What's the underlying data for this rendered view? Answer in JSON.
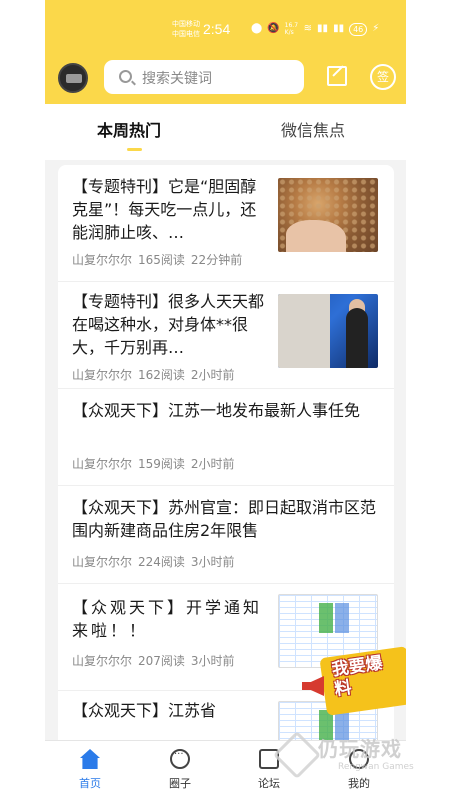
{
  "status_bar": {
    "carrier_1": "中国移动",
    "carrier_2": "中国电信",
    "time": "2:54",
    "net_speed": "16.7 K/s",
    "battery": "46"
  },
  "header": {
    "search_placeholder": "搜索关键词",
    "sign_label": "签",
    "accent_color": "#fbd84a"
  },
  "tabs": [
    {
      "label": "本周热门",
      "active": true
    },
    {
      "label": "微信焦点",
      "active": false
    }
  ],
  "feed": [
    {
      "title": "【专题特刊】它是“胆固醇克星”！每天吃一点儿，还能润肺止咳、…",
      "author": "山复尔尔尔",
      "reads": "165阅读",
      "time": "22分钟前",
      "thumb": "seeds"
    },
    {
      "title": "【专题特刊】很多人天天都在喝这种水，对身体**很大，千万别再…",
      "author": "山复尔尔尔",
      "reads": "162阅读",
      "time": "2小时前",
      "thumb": "news"
    },
    {
      "title": "【众观天下】江苏一地发布最新人事任免",
      "author": "山复尔尔尔",
      "reads": "159阅读",
      "time": "2小时前",
      "thumb": null
    },
    {
      "title": "【众观天下】苏州官宣：即日起取消市区范围内新建商品住房2年限售",
      "author": "山复尔尔尔",
      "reads": "224阅读",
      "time": "3小时前",
      "thumb": null
    },
    {
      "title": "【众观天下】开学通知来啦！！",
      "author": "山复尔尔尔",
      "reads": "207阅读",
      "time": "3小时前",
      "thumb": "table"
    },
    {
      "title": "【众观天下】江苏省",
      "author": "",
      "reads": "",
      "time": "",
      "thumb": "table"
    }
  ],
  "promo_badge": "我要爆料",
  "bottom_nav": [
    {
      "label": "首页",
      "icon": "home-icon",
      "active": true
    },
    {
      "label": "圈子",
      "icon": "chat-circle-icon",
      "active": false
    },
    {
      "label": "论坛",
      "icon": "forum-icon",
      "active": false
    },
    {
      "label": "我的",
      "icon": "profile-icon",
      "active": false
    }
  ],
  "watermark": {
    "title": "仍玩游戏",
    "subtitle": "Rengwan Games"
  }
}
